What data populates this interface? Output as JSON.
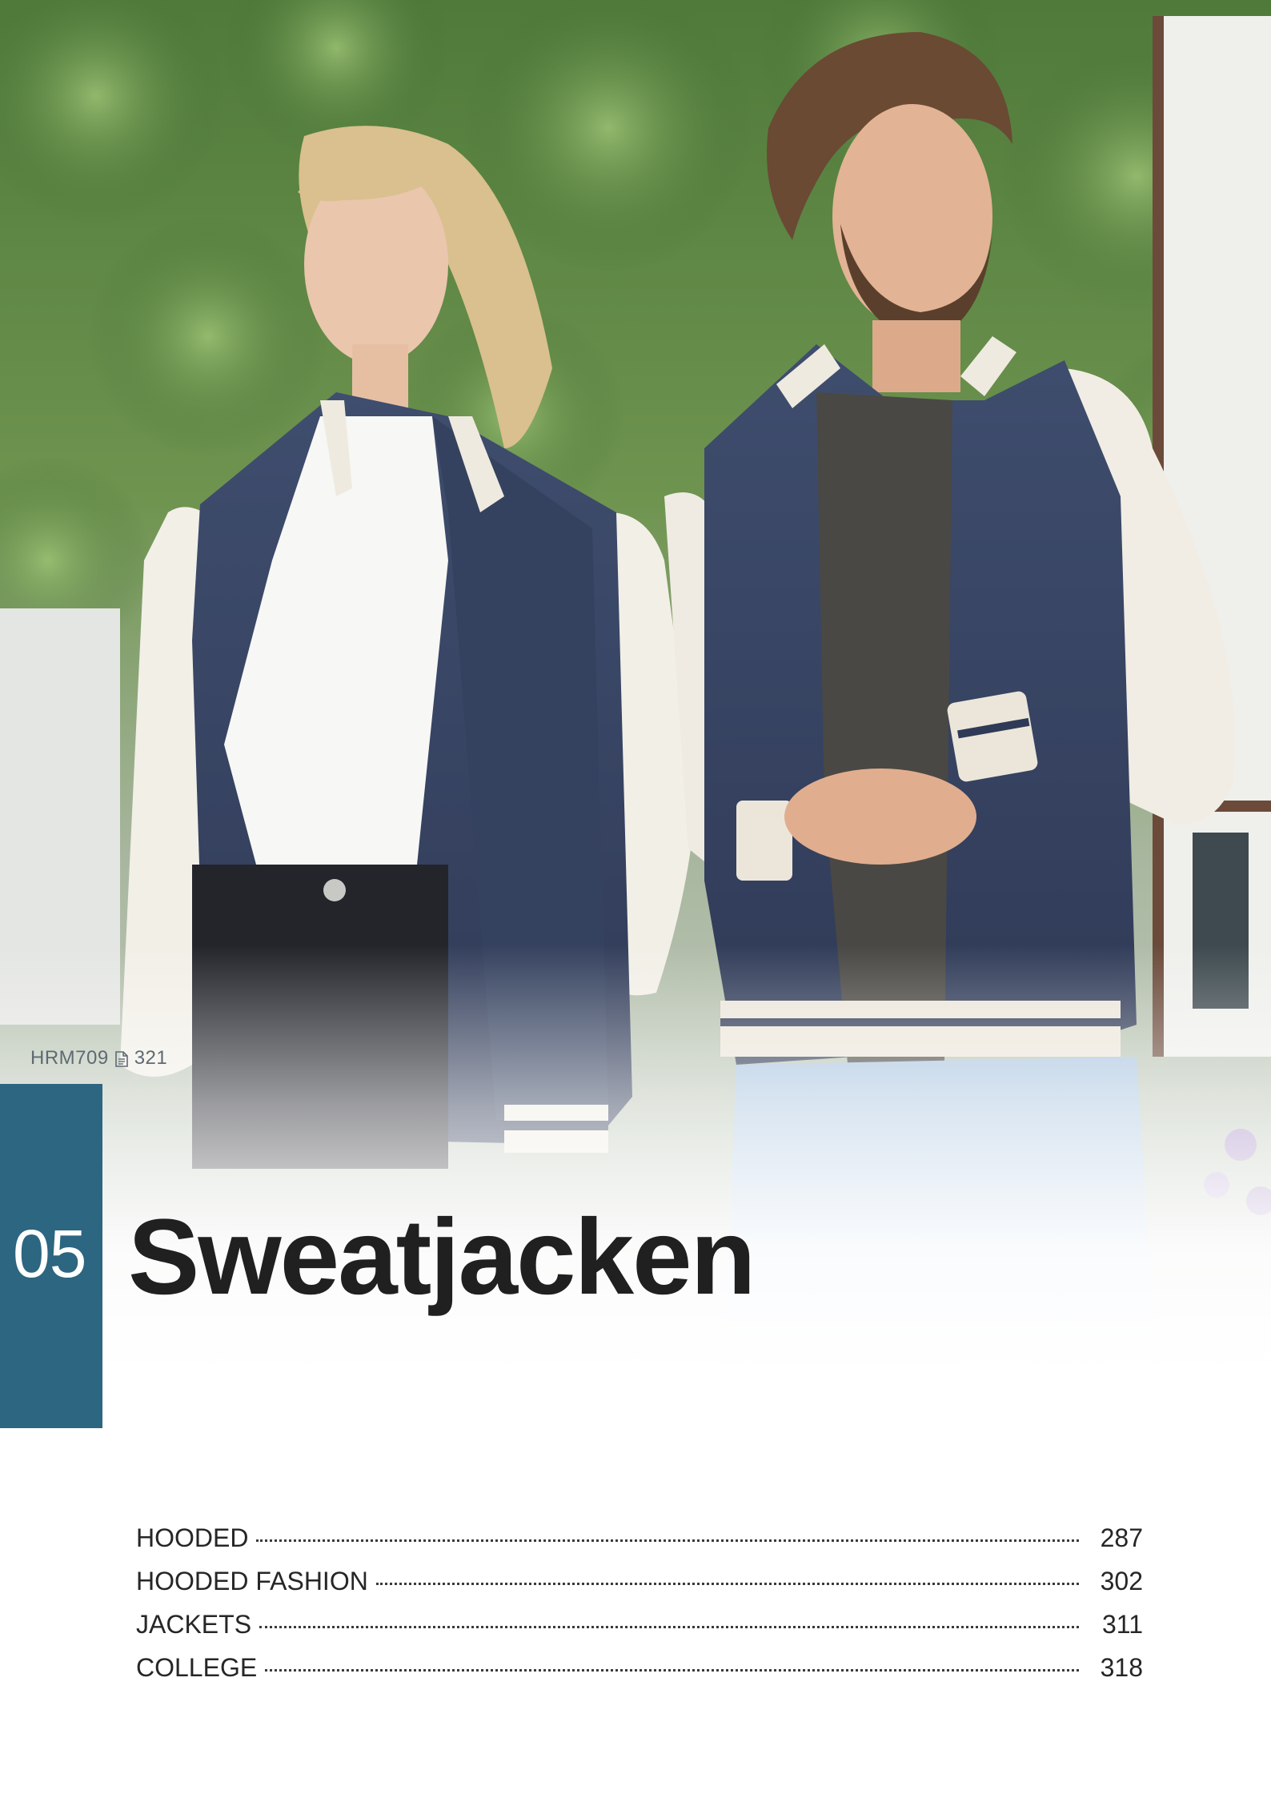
{
  "photo": {
    "code": "HRM709",
    "page_icon": "page-icon",
    "page_ref": "321"
  },
  "chapter": {
    "number": "05",
    "title": "Sweatjacken",
    "band_color": "#2c6680"
  },
  "toc": [
    {
      "label": "HOODED",
      "page": "287"
    },
    {
      "label": "HOODED FASHION",
      "page": "302"
    },
    {
      "label": "JACKETS",
      "page": "311"
    },
    {
      "label": "COLLEGE",
      "page": "318"
    }
  ]
}
